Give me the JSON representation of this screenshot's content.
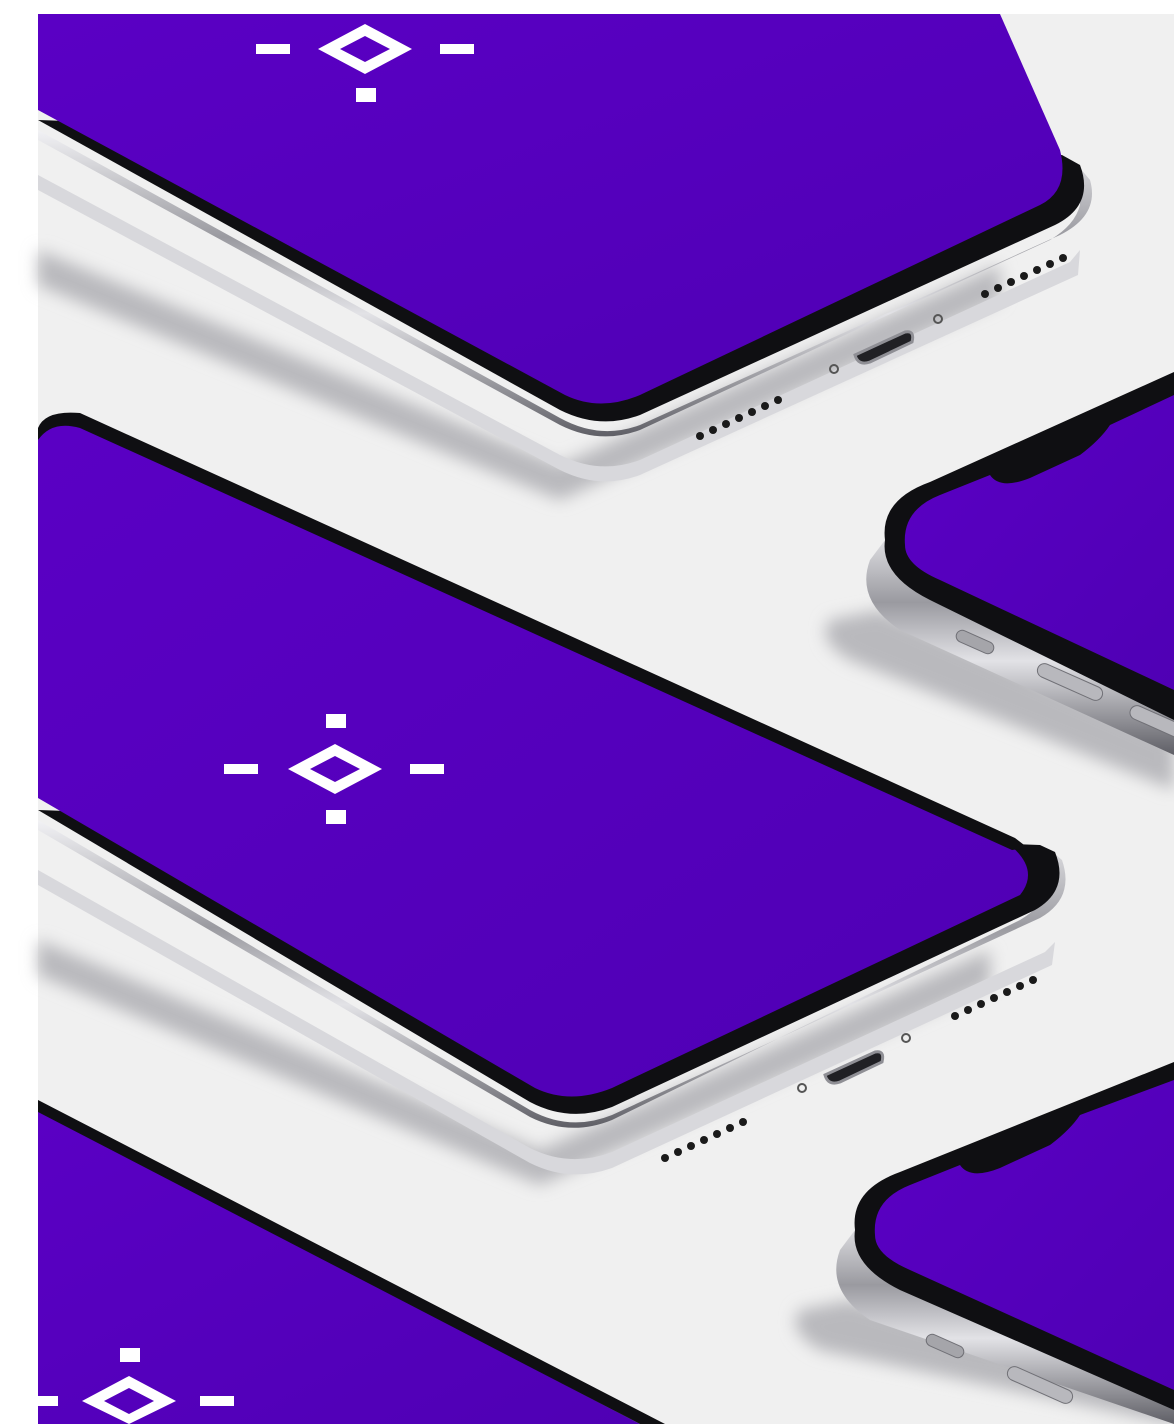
{
  "scene": {
    "description_free": true,
    "colors": {
      "page_margin": "#ffffff",
      "backdrop": "#f0f0f0",
      "screen": "#5400bd",
      "bezel": "#101014",
      "frame_dark": "#6d6d72",
      "frame_light": "#e6e6ea",
      "shadow": "#b8b8bc",
      "logo": "#ffffff"
    },
    "devices": [
      {
        "name": "phone-top",
        "orientation": "screen-up",
        "has_logo": true,
        "ports_visible": true
      },
      {
        "name": "phone-middle",
        "orientation": "screen-up",
        "has_logo": true,
        "ports_visible": true
      },
      {
        "name": "phone-bottom-left",
        "orientation": "screen-up",
        "has_logo": true,
        "ports_visible": false
      },
      {
        "name": "phone-right-upper",
        "orientation": "screen-up",
        "has_logo": false,
        "notch_visible": true
      },
      {
        "name": "phone-right-lower",
        "orientation": "screen-up",
        "has_logo": false,
        "notch_visible": true
      }
    ],
    "logo_icon": "diamond-crosshair-icon"
  }
}
